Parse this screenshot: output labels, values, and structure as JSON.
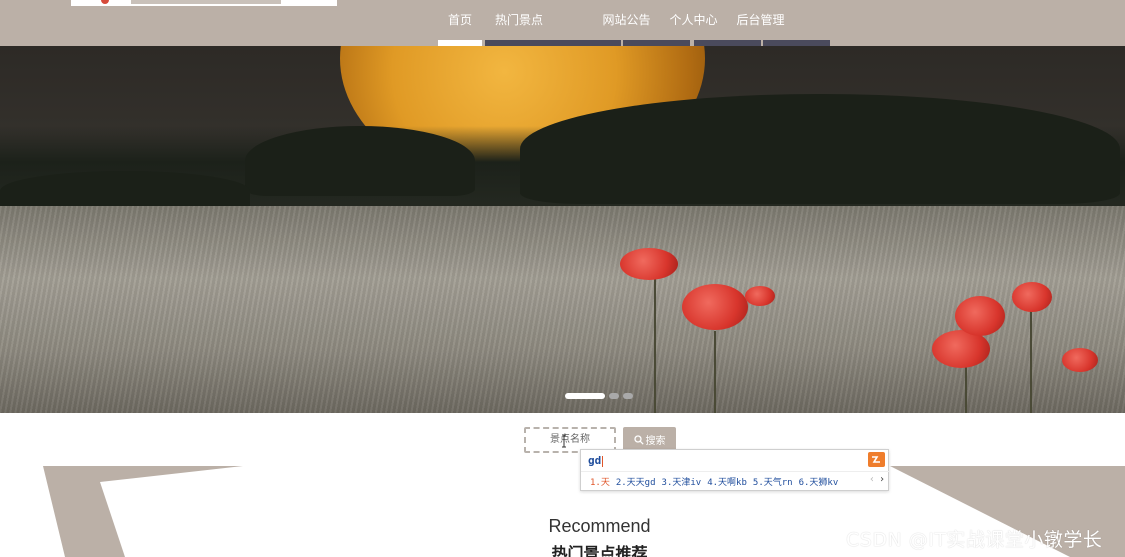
{
  "nav": {
    "items": [
      {
        "label": "首页",
        "active": true
      },
      {
        "label": "热门景点",
        "active": false
      },
      {
        "label": "网站公告",
        "active": false
      },
      {
        "label": "个人中心",
        "active": false
      },
      {
        "label": "后台管理",
        "active": false
      }
    ]
  },
  "hero": {
    "slide_count": 3,
    "active_slide": 1
  },
  "search": {
    "placeholder": "景点名称",
    "button_label": "搜索"
  },
  "ime": {
    "input": "gd",
    "candidates": [
      "1.天",
      "2.天天gd",
      "3.天津iv",
      "4.天啊kb",
      "5.天气rn",
      "6.天狮kv"
    ],
    "prev": "‹",
    "next": "›"
  },
  "recommend": {
    "title": "Recommend",
    "subtitle": "热门景点推荐"
  },
  "watermark": "CSDN @IT实战课堂小镦学长",
  "colors": {
    "header": "#bbb0a7",
    "nav_bar": "#4a4a5c",
    "accent": "#e0562a"
  }
}
